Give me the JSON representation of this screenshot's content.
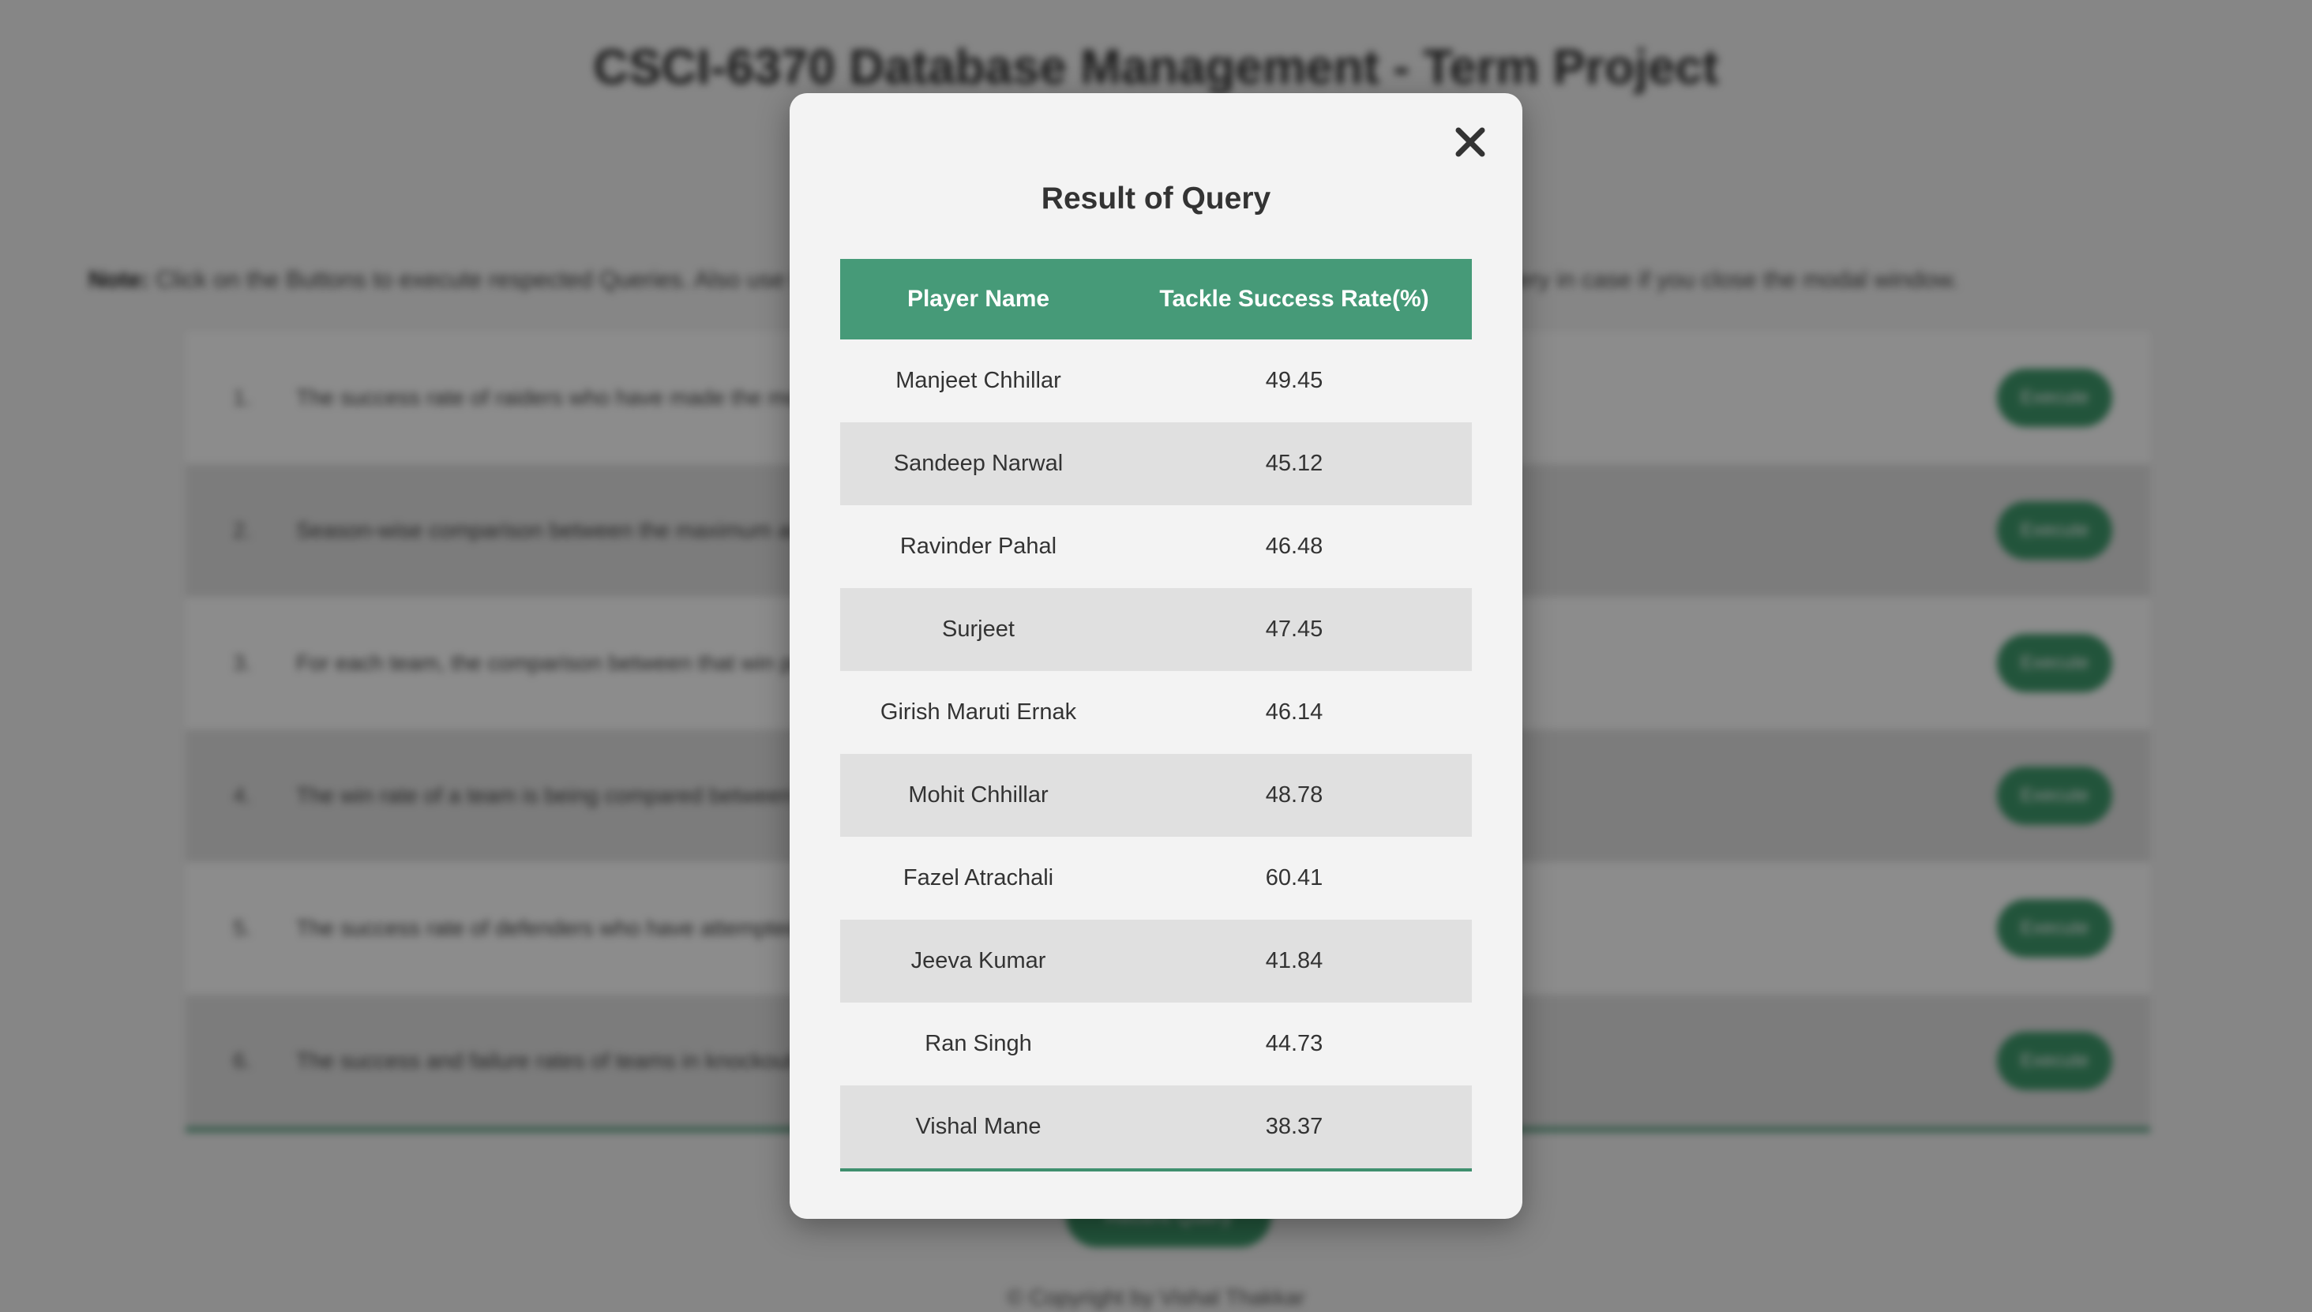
{
  "page": {
    "title": "CSCI-6370 Database Management - Term Project",
    "note_label": "Note:",
    "note_text": " Click on the Buttons to execute respected Queries. Also use the Recently Executed Query button to view the recently executed query in case if you close the modal window.",
    "queries": [
      {
        "num": "1.",
        "text": "The success rate of raiders who have made the most raids in their team",
        "button": "Execute"
      },
      {
        "num": "2.",
        "text": "Season-wise comparison between the maximum and minimum points scored by teams",
        "button": "Execute"
      },
      {
        "num": "3.",
        "text": "For each team, the comparison between that win percentage at home matches and their win percentage at away matches",
        "button": "Execute"
      },
      {
        "num": "4.",
        "text": "The win rate of a team is being compared between the first half and second half of the season matches",
        "button": "Execute"
      },
      {
        "num": "5.",
        "text": "The success rate of defenders who have attempted the most tackles in their team",
        "button": "Execute"
      },
      {
        "num": "6.",
        "text": "The success and failure rates of teams in knockout matches",
        "button": "Execute"
      }
    ],
    "recent_button": "Recent Query",
    "copyright": "© Copyright by Vishal Thakkar"
  },
  "modal": {
    "close_symbol": "close-icon",
    "title": "Result of Query",
    "columns": [
      "Player Name",
      "Tackle Success Rate(%)"
    ],
    "rows": [
      [
        "Manjeet Chhillar",
        "49.45"
      ],
      [
        "Sandeep Narwal",
        "45.12"
      ],
      [
        "Ravinder Pahal",
        "46.48"
      ],
      [
        "Surjeet",
        "47.45"
      ],
      [
        "Girish Maruti Ernak",
        "46.14"
      ],
      [
        "Mohit Chhillar",
        "48.78"
      ],
      [
        "Fazel Atrachali",
        "60.41"
      ],
      [
        "Jeeva Kumar",
        "41.84"
      ],
      [
        "Ran Singh",
        "44.73"
      ],
      [
        "Vishal Mane",
        "38.37"
      ]
    ]
  },
  "colors": {
    "accent": "#469a78",
    "button": "#3f9a6c",
    "modal_bg": "#f3f3f3",
    "row_alt": "#e0e0e0"
  }
}
